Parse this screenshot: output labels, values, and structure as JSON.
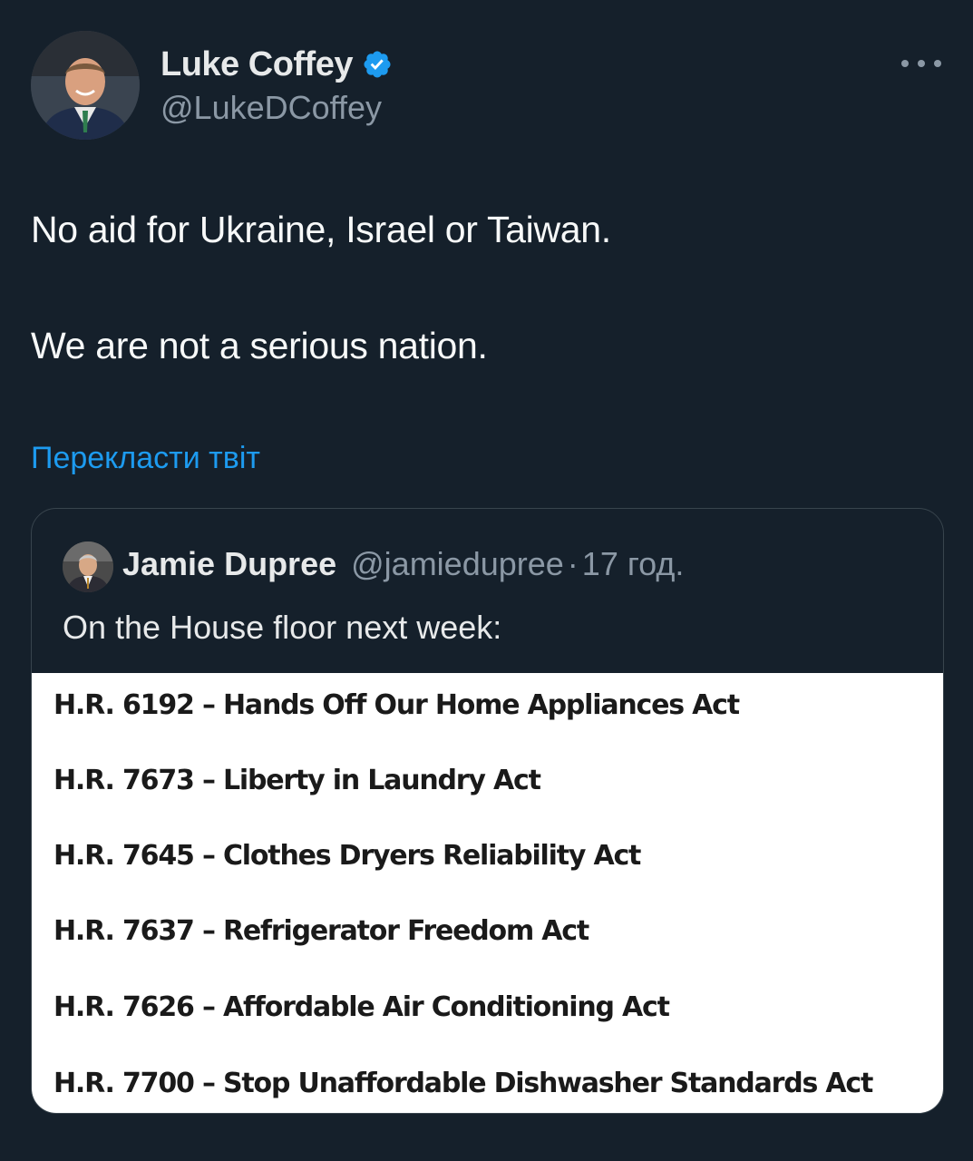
{
  "tweet": {
    "author": {
      "name": "Luke Coffey",
      "handle": "@LukeDCoffey",
      "verified": true
    },
    "text_lines": [
      "No aid for Ukraine, Israel or Taiwan.",
      "We are not a serious nation."
    ],
    "translate_link": "Перекласти твіт",
    "more_icon": "more-horizontal-icon"
  },
  "quoted_tweet": {
    "author": {
      "name": "Jamie Dupree",
      "handle": "@jamiedupree"
    },
    "separator": "·",
    "time": "17 год.",
    "text": "On the House floor next week:",
    "image_bills": [
      "H.R. 6192 – Hands Off Our Home Appliances Act",
      "H.R. 7673 – Liberty in Laundry Act",
      "H.R. 7645 – Clothes Dryers Reliability Act",
      "H.R. 7637 – Refrigerator Freedom Act",
      "H.R. 7626 – Affordable Air Conditioning Act",
      "H.R. 7700 – Stop Unaffordable Dishwasher Standards Act"
    ]
  },
  "colors": {
    "background": "#15202b",
    "link": "#1d9bf0",
    "secondary_text": "#8b98a5",
    "verified_badge": "#1d9bf0"
  }
}
